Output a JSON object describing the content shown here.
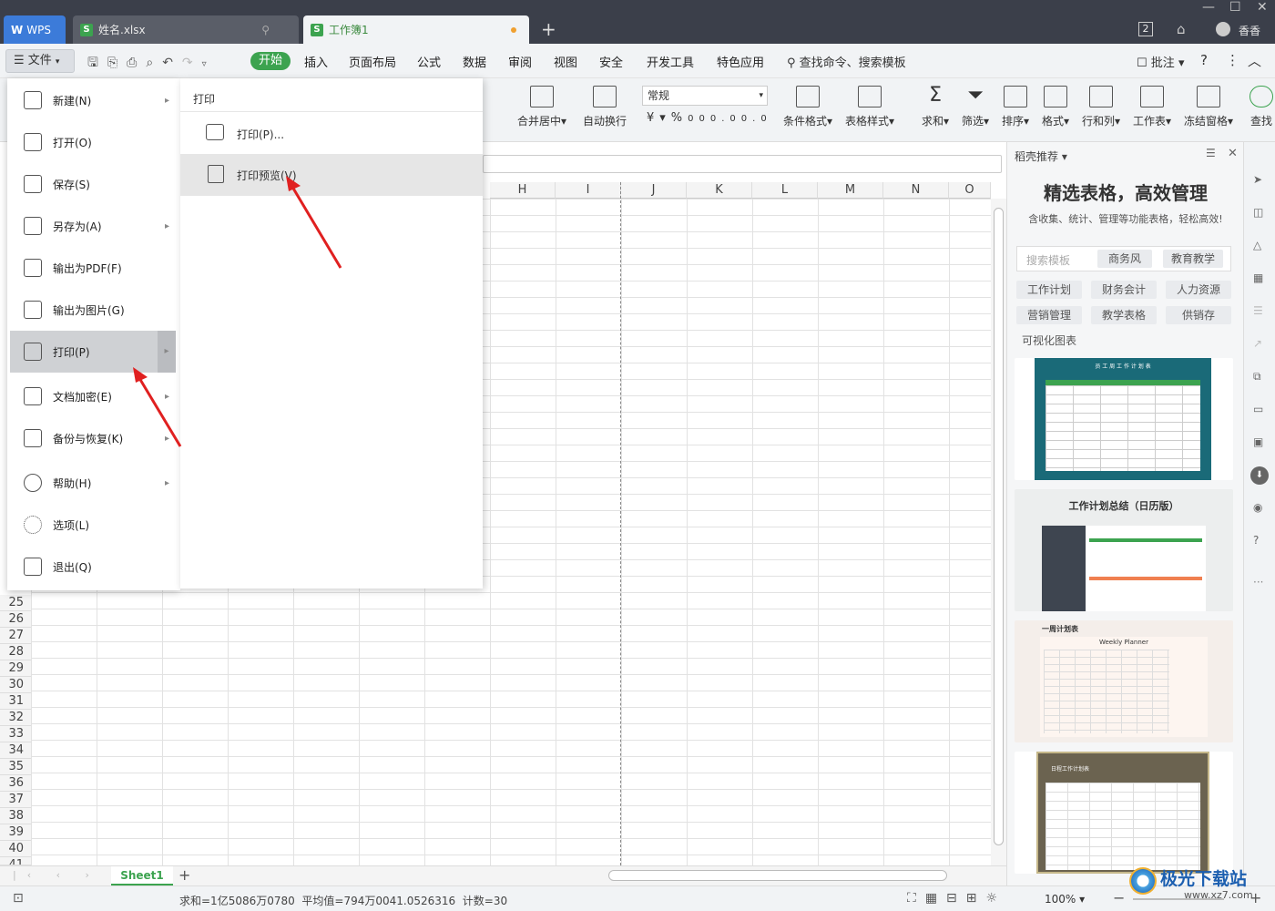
{
  "titlebar": {
    "wps_label": "WPS",
    "tab1": "姓名.xlsx",
    "tab2": "工作簿1",
    "page_num": "2",
    "user": "香香"
  },
  "menubar": {
    "file": "文件",
    "items": [
      "开始",
      "插入",
      "页面布局",
      "公式",
      "数据",
      "审阅",
      "视图",
      "安全",
      "开发工具",
      "特色应用"
    ],
    "search": "查找命令、搜索模板",
    "comment": "批注"
  },
  "ribbon": {
    "format_value": "常规",
    "buttons": [
      "合并居中",
      "自动换行",
      "条件格式",
      "表格样式",
      "求和",
      "筛选",
      "排序",
      "格式",
      "行和列",
      "工作表",
      "冻结窗格",
      "查找"
    ]
  },
  "columns": [
    "H",
    "I",
    "J",
    "K",
    "L",
    "M",
    "N",
    "O"
  ],
  "rows": [
    "25",
    "26",
    "27",
    "28",
    "29",
    "30",
    "31",
    "32",
    "33",
    "34",
    "35",
    "36",
    "37",
    "38",
    "39",
    "40",
    "41"
  ],
  "filemenu": {
    "items": [
      {
        "label": "新建(N)",
        "arrow": true
      },
      {
        "label": "打开(O)",
        "arrow": false
      },
      {
        "label": "保存(S)",
        "arrow": false
      },
      {
        "label": "另存为(A)",
        "arrow": true
      },
      {
        "label": "输出为PDF(F)",
        "arrow": false
      },
      {
        "label": "输出为图片(G)",
        "arrow": false
      },
      {
        "label": "打印(P)",
        "arrow": true
      },
      {
        "label": "文档加密(E)",
        "arrow": true
      },
      {
        "label": "备份与恢复(K)",
        "arrow": true
      },
      {
        "label": "帮助(H)",
        "arrow": true
      },
      {
        "label": "选项(L)",
        "arrow": false
      },
      {
        "label": "退出(Q)",
        "arrow": false
      }
    ]
  },
  "submenu": {
    "title": "打印",
    "print": "打印(P)...",
    "preview": "打印预览(V)"
  },
  "sidepanel": {
    "header": "稻壳推荐",
    "headline": "精选表格，高效管理",
    "subline": "含收集、统计、管理等功能表格，轻松高效!",
    "search_placeholder": "搜索模板",
    "search_tags": [
      "商务风",
      "教育教学"
    ],
    "tags": [
      "工作计划",
      "财务会计",
      "人力资源",
      "营销管理",
      "教学表格",
      "供销存",
      "可视化图表"
    ],
    "thumb1_title": "员 工 周 工 作 计 划 表",
    "thumb2_title": "工作计划总结（日历版）",
    "thumb3_title": "一周计划表",
    "thumb3_sub": "Weekly Planner",
    "thumb4_title": "日程工作计划表"
  },
  "sheetbar": {
    "sheet": "Sheet1"
  },
  "statusbar": {
    "stats": "求和=1亿5086万0780  平均值=794万0041.0526316  计数=30",
    "zoom": "100%"
  },
  "watermark": {
    "name": "极光下载站",
    "url": "www.xz7.com"
  }
}
